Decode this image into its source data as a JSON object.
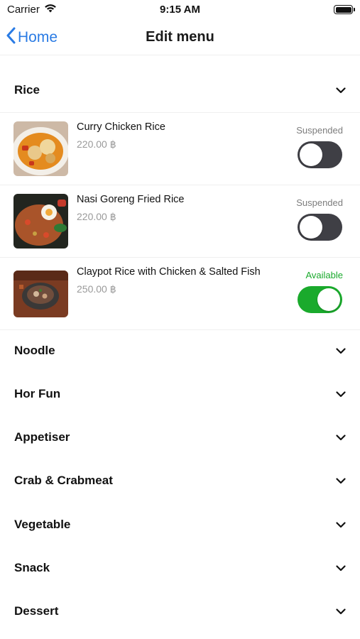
{
  "status_bar": {
    "carrier": "Carrier",
    "time": "9:15 AM"
  },
  "nav": {
    "back_label": "Home",
    "title": "Edit menu"
  },
  "rice_section": {
    "label": "Rice",
    "expanded": true
  },
  "items": [
    {
      "name": "Curry Chicken Rice",
      "price": "220.00 ฿",
      "status": "Suspended",
      "enabled": false,
      "image": "curry-chicken-rice-photo"
    },
    {
      "name": "Nasi Goreng Fried Rice",
      "price": "220.00 ฿",
      "status": "Suspended",
      "enabled": false,
      "image": "nasi-goreng-photo"
    },
    {
      "name": "Claypot Rice with Chicken & Salted Fish",
      "price": "250.00 ฿",
      "status": "Available",
      "enabled": true,
      "image": "claypot-rice-photo"
    }
  ],
  "sections": [
    {
      "label": "Noodle"
    },
    {
      "label": "Hor Fun"
    },
    {
      "label": "Appetiser"
    },
    {
      "label": "Crab & Crabmeat"
    },
    {
      "label": "Vegetable"
    },
    {
      "label": "Snack"
    },
    {
      "label": "Dessert"
    }
  ],
  "colors": {
    "accent": "#2a7be4",
    "available": "#1aaa2c",
    "toggle_off": "#3f3f45"
  }
}
